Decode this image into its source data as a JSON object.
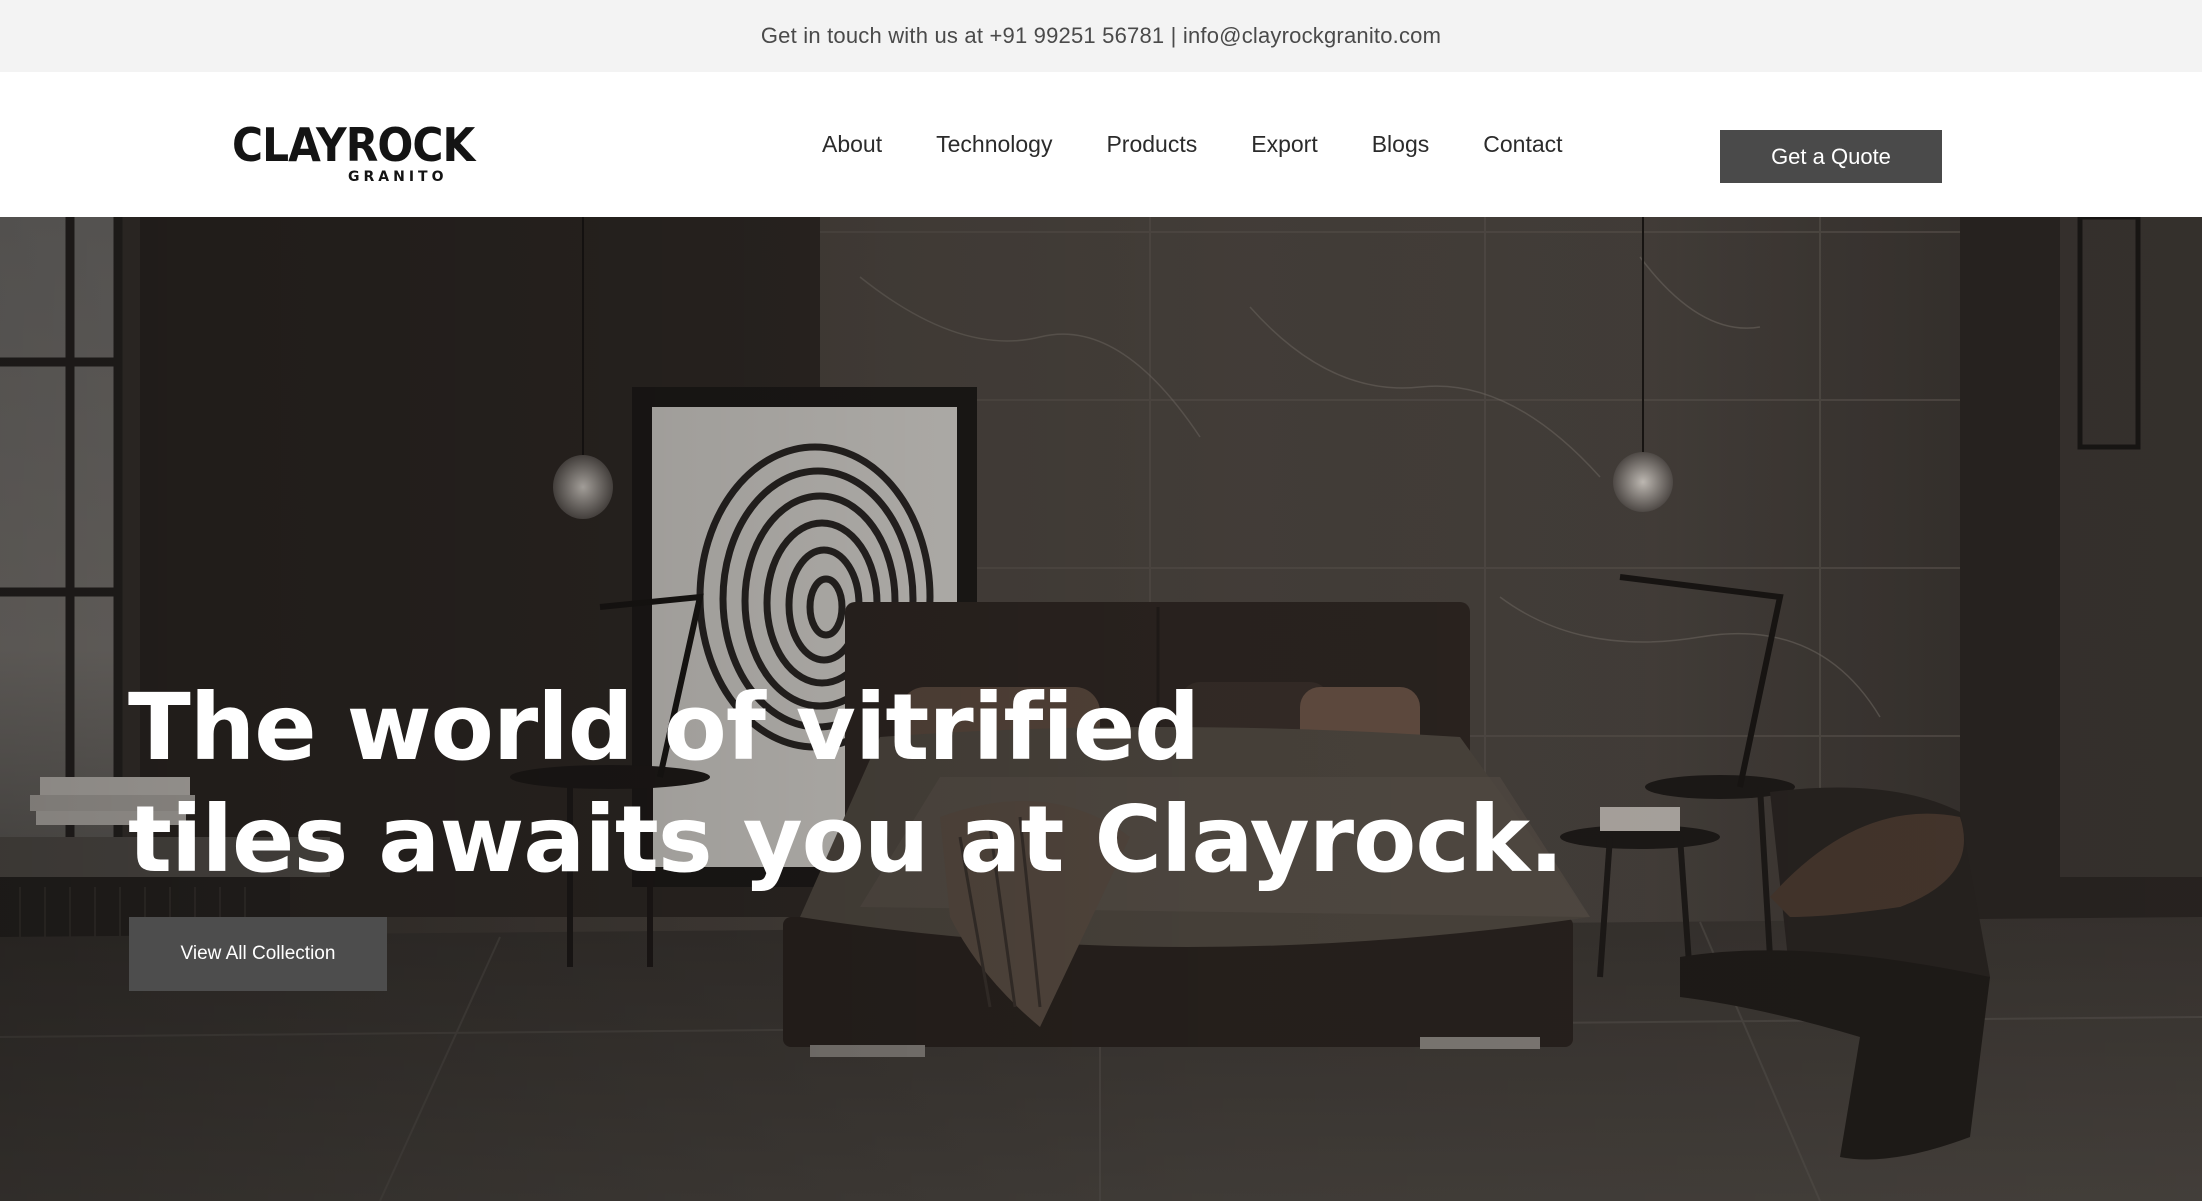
{
  "topbar": {
    "contact_text": "Get in touch with us at +91 99251 56781 | info@clayrockgranito.com"
  },
  "brand": {
    "name": "CLAYROCK",
    "tagline": "GRANITO"
  },
  "nav": {
    "items": [
      "About",
      "Technology",
      "Products",
      "Export",
      "Blogs",
      "Contact"
    ]
  },
  "header": {
    "cta_label": "Get a Quote"
  },
  "hero": {
    "title_line1": "The world of vitrified",
    "title_line2": "tiles awaits you at Clayrock.",
    "button_label": "View All Collection"
  },
  "colors": {
    "topbar_bg": "#f3f3f3",
    "button_bg": "#4a4a4a",
    "text_dark": "#2b2b2b"
  }
}
